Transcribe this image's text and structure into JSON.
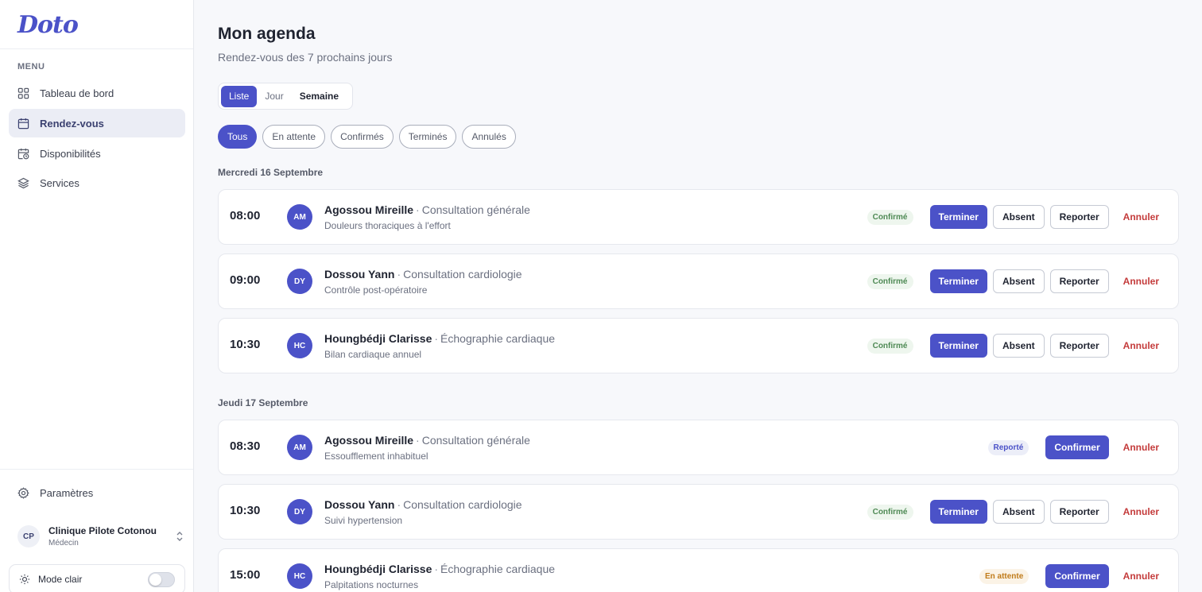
{
  "app": {
    "logo": "Doto"
  },
  "sidebar": {
    "menu_label": "MENU",
    "items": [
      {
        "label": "Tableau de bord",
        "icon": "dashboard-icon"
      },
      {
        "label": "Rendez-vous",
        "icon": "calendar-icon",
        "active": true
      },
      {
        "label": "Disponibilités",
        "icon": "calendar-clock-icon"
      },
      {
        "label": "Services",
        "icon": "layers-icon"
      }
    ],
    "settings": {
      "label": "Paramètres",
      "icon": "gear-icon"
    },
    "org": {
      "initials": "CP",
      "name": "Clinique Pilote Cotonou",
      "role": "Médecin"
    },
    "mode": {
      "label": "Mode clair",
      "icon": "sun-icon",
      "enabled": false
    }
  },
  "header": {
    "title": "Mon agenda",
    "subtitle": "Rendez-vous des 7 prochains jours"
  },
  "view_tabs": [
    {
      "label": "Liste",
      "active": true
    },
    {
      "label": "Jour"
    },
    {
      "label": "Semaine"
    }
  ],
  "filters": [
    {
      "label": "Tous",
      "active": true
    },
    {
      "label": "En attente"
    },
    {
      "label": "Confirmés"
    },
    {
      "label": "Terminés"
    },
    {
      "label": "Annulés"
    }
  ],
  "actions": {
    "terminer": "Terminer",
    "absent": "Absent",
    "reporter": "Reporter",
    "annuler": "Annuler",
    "confirmer": "Confirmer"
  },
  "days": [
    {
      "label": "Mercredi 16 Septembre",
      "appointments": [
        {
          "time": "08:00",
          "initials": "AM",
          "patient": "Agossou Mireille",
          "service": "Consultation générale",
          "note": "Douleurs thoraciques à l'effort",
          "status": "Confirmé",
          "status_color": "#4f8a55"
        },
        {
          "time": "09:00",
          "initials": "DY",
          "patient": "Dossou Yann",
          "service": "Consultation cardiologie",
          "note": "Contrôle post-opératoire",
          "status": "Confirmé",
          "status_color": "#4f8a55"
        },
        {
          "time": "10:30",
          "initials": "HC",
          "patient": "Houngbédji Clarisse",
          "service": "Échographie cardiaque",
          "note": "Bilan cardiaque annuel",
          "status": "Confirmé",
          "status_color": "#4f8a55"
        }
      ]
    },
    {
      "label": "Jeudi 17 Septembre",
      "appointments": [
        {
          "time": "08:30",
          "initials": "AM",
          "patient": "Agossou Mireille",
          "service": "Consultation générale",
          "note": "Essoufflement inhabituel",
          "status": "Reporté",
          "status_color": "#4b52c8"
        },
        {
          "time": "10:30",
          "initials": "DY",
          "patient": "Dossou Yann",
          "service": "Consultation cardiologie",
          "note": "Suivi hypertension",
          "status": "Confirmé",
          "status_color": "#4f8a55"
        },
        {
          "time": "15:00",
          "initials": "HC",
          "patient": "Houngbédji Clarisse",
          "service": "Échographie cardiaque",
          "note": "Palpitations nocturnes",
          "status": "En attente",
          "status_color": "#c07b1a"
        }
      ]
    }
  ],
  "colors": {
    "accent": "#4b52c8",
    "danger": "#c43b3b",
    "confirmed": "#4f8a55",
    "pending": "#c07b1a"
  }
}
